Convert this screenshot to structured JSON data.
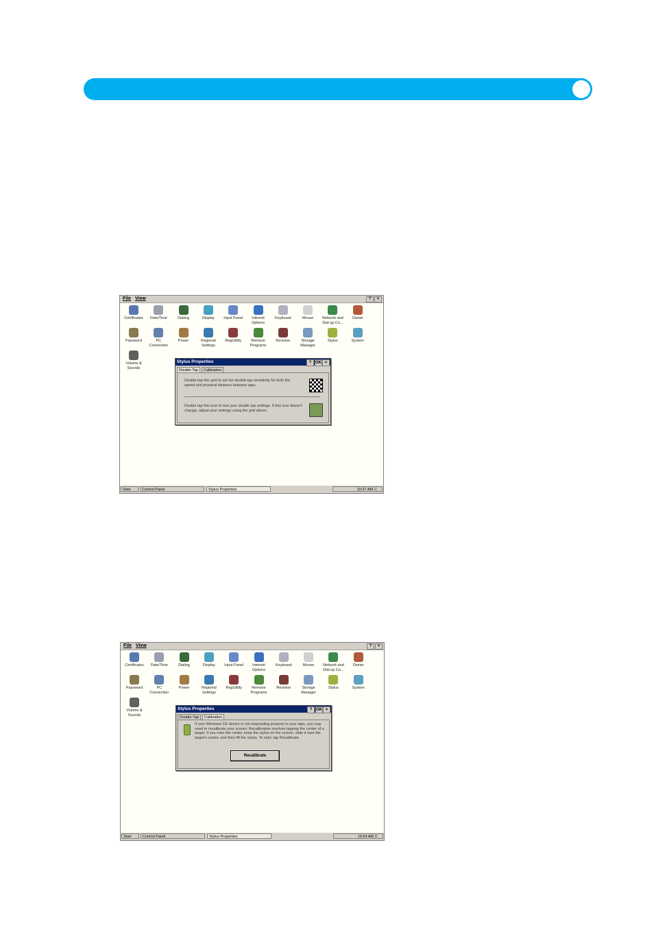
{
  "menu": {
    "file": "File",
    "view": "View",
    "help": "?",
    "close": "×"
  },
  "icons": [
    {
      "label": "Certificates",
      "icon": "certificates-icon",
      "color": "#5a78b0"
    },
    {
      "label": "Date/Time",
      "icon": "clock-icon",
      "color": "#9aa0b0"
    },
    {
      "label": "Dialing",
      "icon": "phone-icon",
      "color": "#3a6a3a"
    },
    {
      "label": "Display",
      "icon": "monitor-icon",
      "color": "#4aa0c0"
    },
    {
      "label": "Input Panel",
      "icon": "input-panel-icon",
      "color": "#6a88c8"
    },
    {
      "label": "Internet Options",
      "icon": "globe-icon",
      "color": "#3a70c0"
    },
    {
      "label": "Keyboard",
      "icon": "keyboard-icon",
      "color": "#b0b0c0"
    },
    {
      "label": "Mouse",
      "icon": "mouse-icon",
      "color": "#d0d0d0"
    },
    {
      "label": "Network and Dial up Co...",
      "icon": "network-icon",
      "color": "#3a8a4a"
    },
    {
      "label": "Owner",
      "icon": "owner-icon",
      "color": "#b05a3a"
    },
    {
      "label": "Password",
      "icon": "password-icon",
      "color": "#8a7a50"
    },
    {
      "label": "PC Connection",
      "icon": "pc-connection-icon",
      "color": "#6080b0"
    },
    {
      "label": "Power",
      "icon": "power-icon",
      "color": "#a07a40"
    },
    {
      "label": "Regional Settings",
      "icon": "regional-icon",
      "color": "#3a7ab0"
    },
    {
      "label": "RegUtility",
      "icon": "regutility-icon",
      "color": "#8a3a3a"
    },
    {
      "label": "Remove Programs",
      "icon": "remove-programs-icon",
      "color": "#4a8a3a"
    },
    {
      "label": "Revision",
      "icon": "revision-icon",
      "color": "#7a3a3a"
    },
    {
      "label": "Storage Manager",
      "icon": "storage-icon",
      "color": "#7a9ac0"
    },
    {
      "label": "Stylus",
      "icon": "stylus-icon",
      "color": "#a0b040"
    },
    {
      "label": "System",
      "icon": "system-icon",
      "color": "#5aa0c0"
    },
    {
      "label": "Volume & Sounds",
      "icon": "volume-icon",
      "color": "#606060"
    }
  ],
  "dialog": {
    "title": "Stylus Properties",
    "help": "?",
    "ok": "OK",
    "close": "×",
    "tab_double_tap": "Double-Tap",
    "tab_calibration": "Calibration"
  },
  "screen1": {
    "text1": "Double-tap this grid to set the double-tap sensitivity for both the speed and physical distance between taps.",
    "text2": "Double tap this icon to test your double tap settings. If this icon doesn't change, adjust your settings using the grid above."
  },
  "screen2": {
    "text": "If your Windows CE device is not responding properly to your taps, you may need to recalibrate your screen. Recalibration involves tapping the center of a target. If you miss the center, keep the stylus on the screen, slide it over the target's center, and then lift the stylus. To start, tap Recalibrate.",
    "button": "Recalibrate"
  },
  "taskbar": {
    "start": "Start",
    "control_panel": "Control Panel",
    "active_task": "Stylus Properties",
    "clock1": "10:37 AM",
    "clock2": "10:54 AM"
  }
}
